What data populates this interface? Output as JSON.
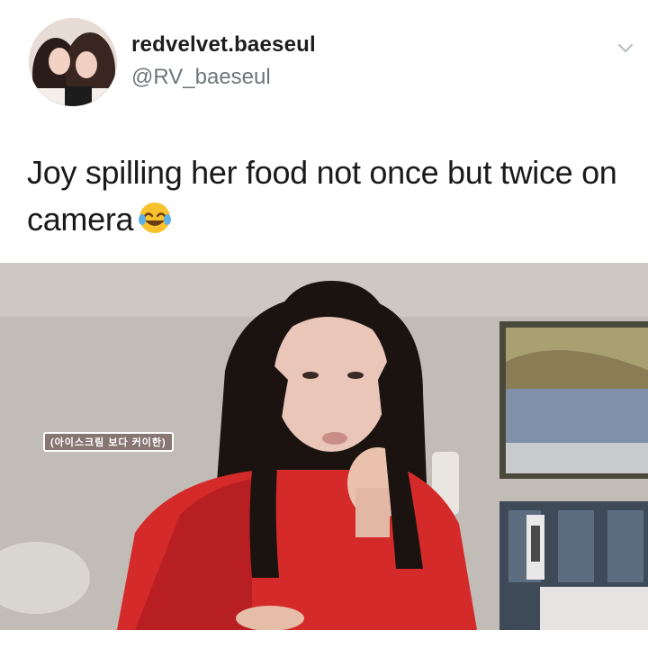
{
  "tweet": {
    "display_name": "redvelvet.baeseul",
    "handle": "@RV_baeseul",
    "text": "Joy spilling her food not once but twice on camera",
    "emoji": "rolling-on-floor-laughing-emoji"
  },
  "video": {
    "caption_sticker": "(아이스크림 보다 커이한)"
  },
  "icons": {
    "menu": "chevron-down-icon"
  }
}
